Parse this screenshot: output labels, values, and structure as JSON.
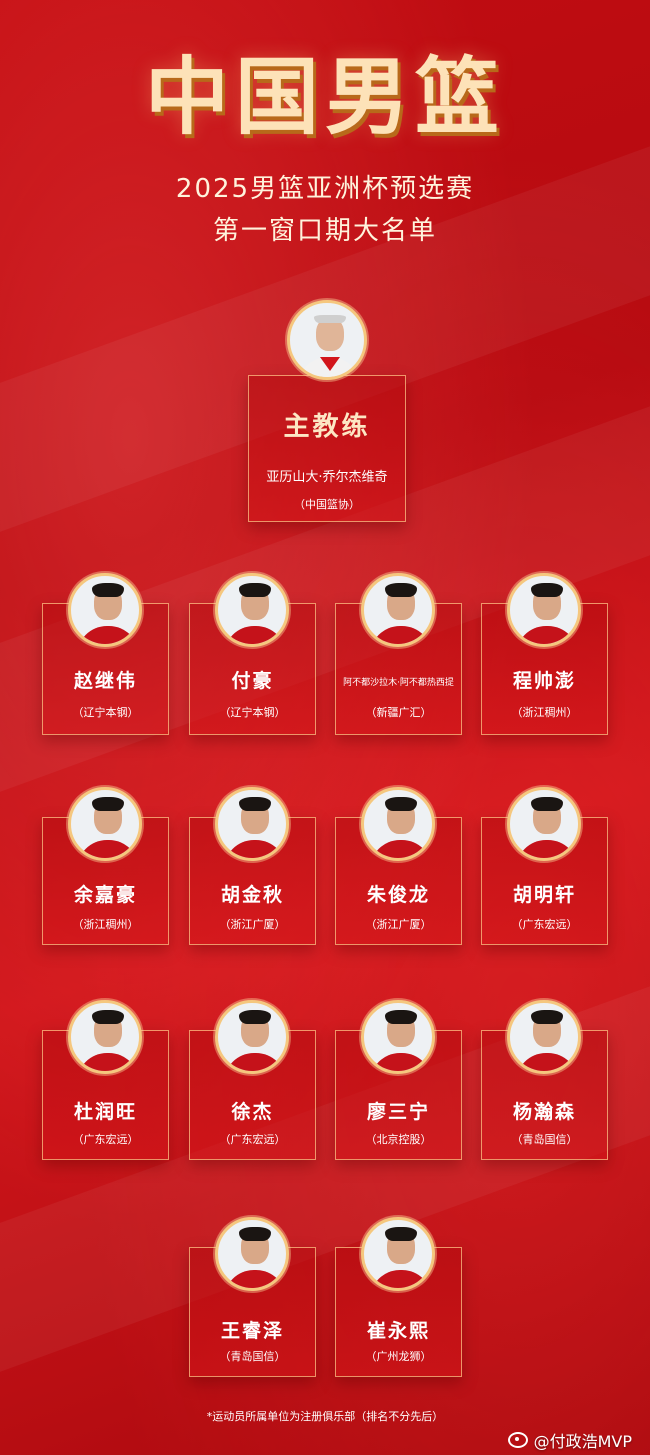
{
  "header": {
    "title": "中国男篮",
    "subtitle_line1": "2025男篮亚洲杯预选赛",
    "subtitle_line2": "第一窗口期大名单"
  },
  "coach": {
    "role": "主教练",
    "name": "亚历山大·乔尔杰维奇",
    "club": "（中国篮协）"
  },
  "players": [
    {
      "name": "赵继伟",
      "club": "（辽宁本钢）"
    },
    {
      "name": "付豪",
      "club": "（辽宁本钢）"
    },
    {
      "name": "阿不都沙拉木·阿不都热西提",
      "club": "（新疆广汇）"
    },
    {
      "name": "程帅澎",
      "club": "（浙江稠州）"
    },
    {
      "name": "余嘉豪",
      "club": "（浙江稠州）"
    },
    {
      "name": "胡金秋",
      "club": "（浙江广厦）"
    },
    {
      "name": "朱俊龙",
      "club": "（浙江广厦）"
    },
    {
      "name": "胡明轩",
      "club": "（广东宏远）"
    },
    {
      "name": "杜润旺",
      "club": "（广东宏远）"
    },
    {
      "name": "徐杰",
      "club": "（广东宏远）"
    },
    {
      "name": "廖三宁",
      "club": "（北京控股）"
    },
    {
      "name": "杨瀚森",
      "club": "（青岛国信）"
    },
    {
      "name": "王睿泽",
      "club": "（青岛国信）"
    },
    {
      "name": "崔永熙",
      "club": "（广州龙狮）"
    }
  ],
  "footnote": "*运动员所属单位为注册俱乐部（排名不分先后）",
  "watermark": {
    "icon": "weibo-icon",
    "text": "@付政浩MVP"
  },
  "colors": {
    "background": "#c20d12",
    "title_gold": "#fde2b8",
    "border_gold": "#f5c77e"
  }
}
